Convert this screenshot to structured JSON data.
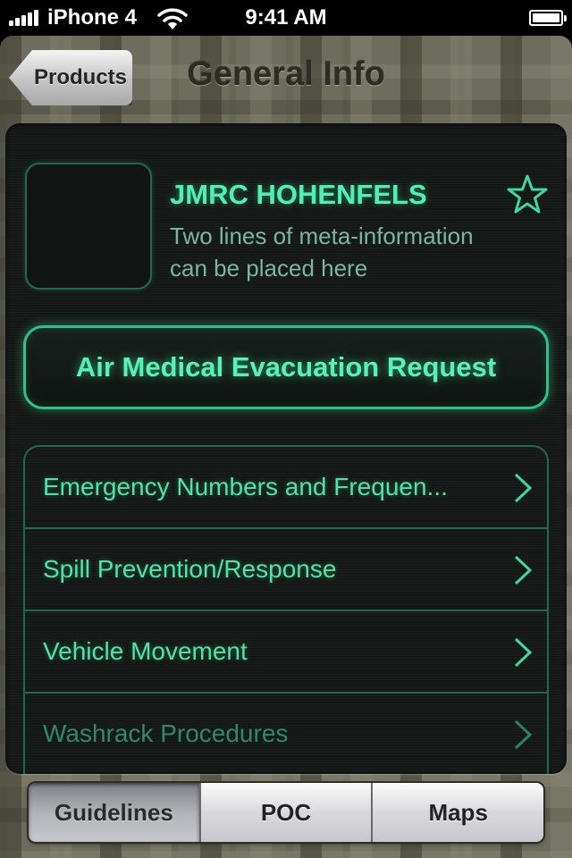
{
  "status_bar": {
    "carrier": "iPhone 4",
    "time": "9:41 AM",
    "icons": [
      "signal-bars-icon",
      "wifi-icon",
      "battery-icon"
    ]
  },
  "nav": {
    "back_label": "Products",
    "title": "General Info"
  },
  "header": {
    "title": "JMRC HOHENFELS",
    "meta_lines": [
      "Two lines of meta-information",
      "can be placed here"
    ],
    "favorite_icon": "star-outline-icon"
  },
  "primary_action": {
    "label": "Air Medical Evacuation Request"
  },
  "list": {
    "items": [
      {
        "label": "Emergency Numbers and Frequen...",
        "icon": "chevron-right-icon"
      },
      {
        "label": "Spill Prevention/Response",
        "icon": "chevron-right-icon"
      },
      {
        "label": "Vehicle Movement",
        "icon": "chevron-right-icon"
      },
      {
        "label": "Washrack Procedures",
        "icon": "chevron-right-icon"
      }
    ]
  },
  "tabs": {
    "items": [
      {
        "label": "Guidelines",
        "selected": true
      },
      {
        "label": "POC",
        "selected": false
      },
      {
        "label": "Maps",
        "selected": false
      }
    ]
  },
  "colors": {
    "accent": "#4ff0b4",
    "panel_background": "#141816",
    "border_green": "#1f6a4e",
    "camo_base": "#6d6c5d"
  }
}
